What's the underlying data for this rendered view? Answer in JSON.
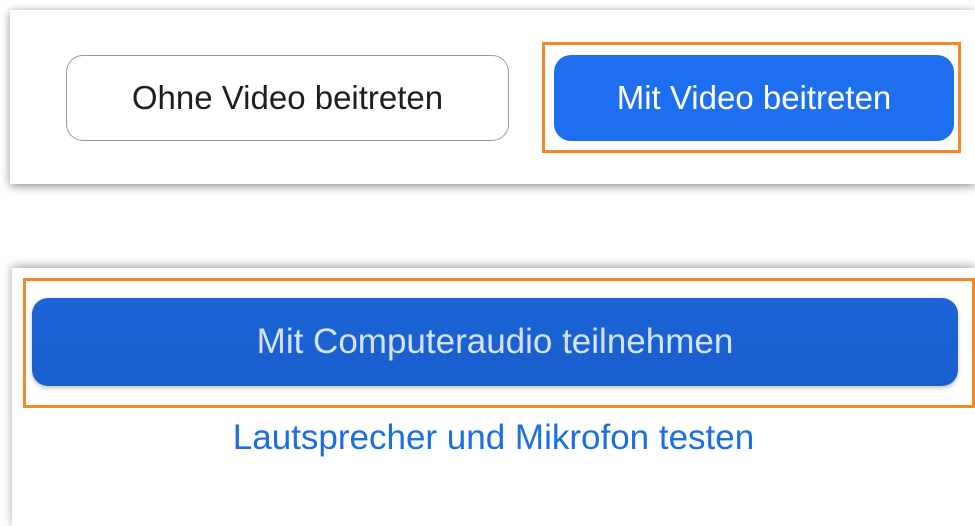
{
  "video_panel": {
    "no_video_button": "Ohne Video beitreten",
    "video_button": "Mit Video beitreten"
  },
  "audio_panel": {
    "computer_audio_button": "Mit Computeraudio teilnehmen",
    "test_link": "Lautsprecher und Mikrofon testen"
  },
  "colors": {
    "primary_blue": "#1e6ff0",
    "audio_button_blue": "#1a5fce",
    "link_blue": "#1b6fe0",
    "highlight_orange": "#f28a2a",
    "outline_gray": "#9a9a9a"
  }
}
